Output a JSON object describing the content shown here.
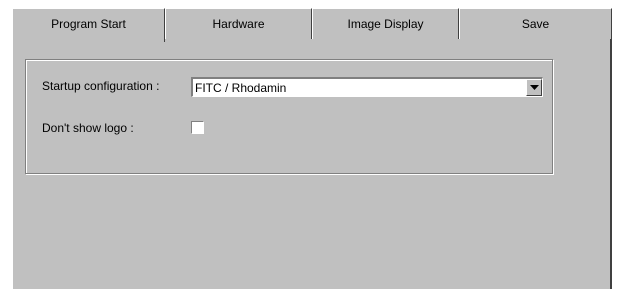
{
  "tabs": [
    {
      "label": "Program Start",
      "active": true
    },
    {
      "label": "Hardware",
      "active": false
    },
    {
      "label": "Image Display",
      "active": false
    },
    {
      "label": "Save",
      "active": false
    }
  ],
  "program_start": {
    "startup_label": "Startup configuration :",
    "startup_value": "FITC / Rhodamin",
    "dropdown_icon": "chevron-down-icon",
    "logo_label": "Don't show logo :",
    "logo_checked": false
  }
}
